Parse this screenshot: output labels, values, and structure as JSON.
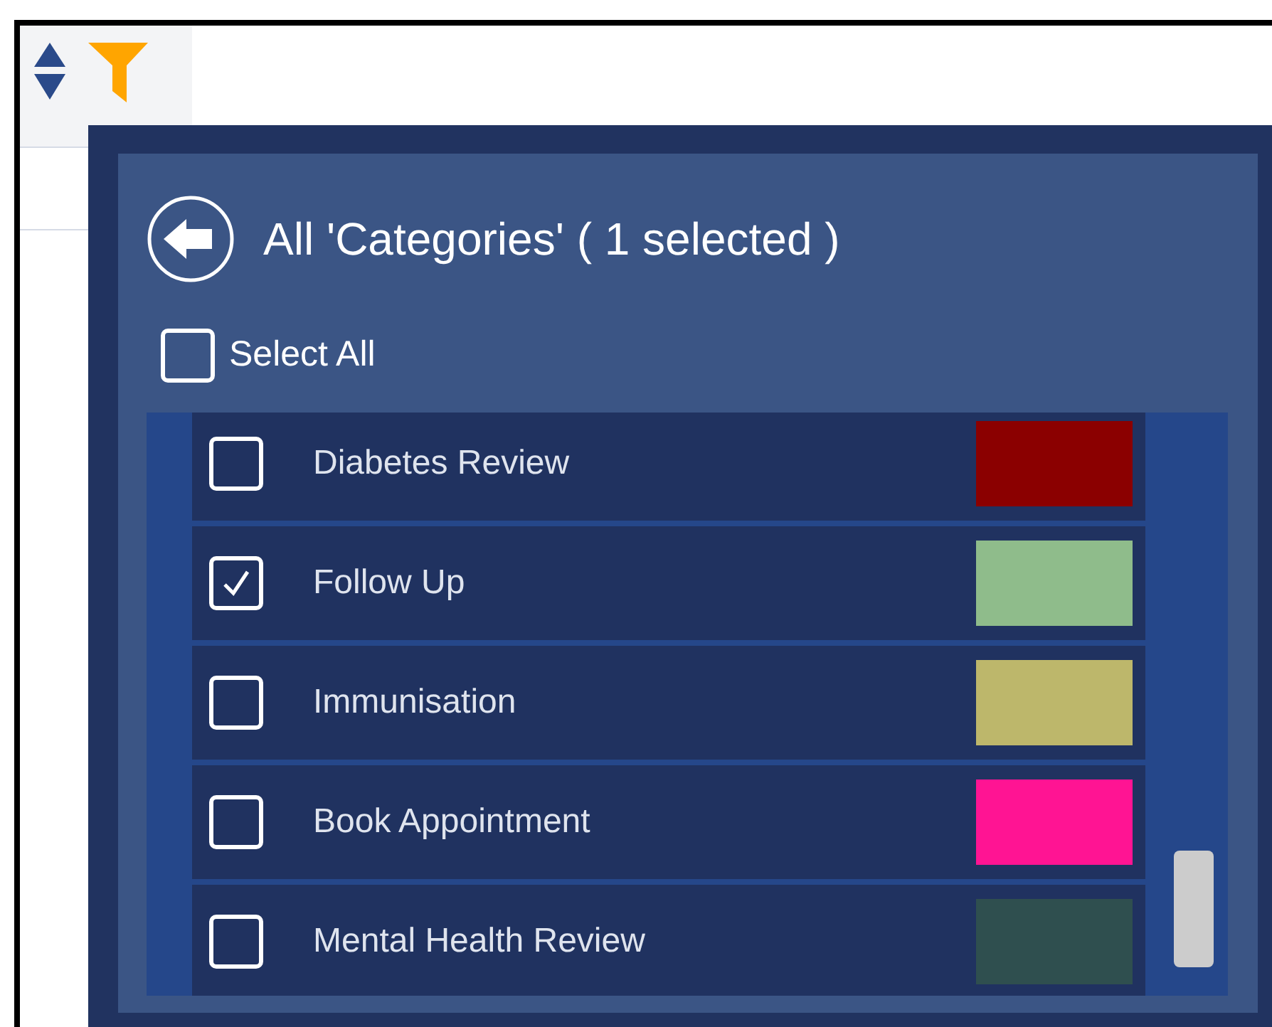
{
  "popup": {
    "title": "All 'Categories' ( 1 selected )",
    "select_all": {
      "label": "Select All",
      "checked": false
    },
    "categories": [
      {
        "label": "Diabetes Review",
        "checked": false,
        "color": "#8b0000"
      },
      {
        "label": "Follow Up",
        "checked": true,
        "color": "#8fbc8b"
      },
      {
        "label": "Immunisation",
        "checked": false,
        "color": "#bdb76b"
      },
      {
        "label": "Book Appointment",
        "checked": false,
        "color": "#ff1493"
      },
      {
        "label": "Mental Health Review",
        "checked": false,
        "color": "#2f4f4f"
      }
    ]
  }
}
